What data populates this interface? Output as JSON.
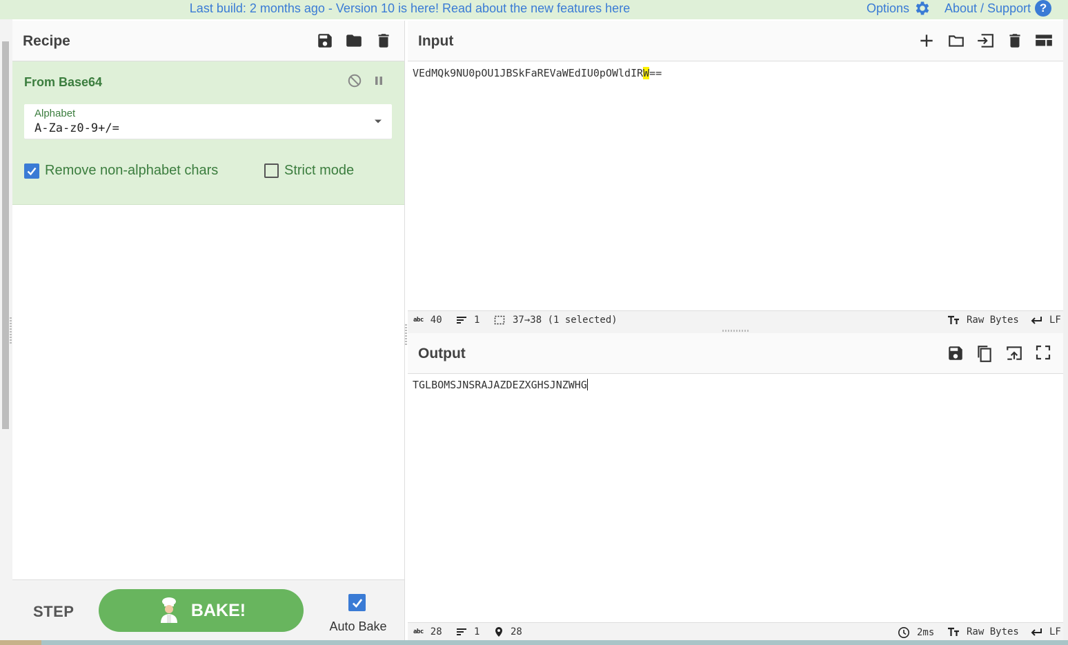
{
  "banner": {
    "message": "Last build: 2 months ago - Version 10 is here! Read about the new features here",
    "options_label": "Options",
    "about_label": "About / Support",
    "help_glyph": "?"
  },
  "recipe": {
    "title": "Recipe",
    "icons": [
      "save-icon",
      "folder-icon",
      "trash-icon"
    ],
    "operation": {
      "title": "From Base64",
      "alphabet_label": "Alphabet",
      "alphabet_value": "A-Za-z0-9+/=",
      "remove_non_alphabet_label": "Remove non-alphabet chars",
      "remove_non_alphabet_checked": true,
      "strict_mode_label": "Strict mode",
      "strict_mode_checked": false
    },
    "footer": {
      "step_label": "STEP",
      "bake_label": "BAKE!",
      "auto_bake_label": "Auto Bake",
      "auto_bake_checked": true
    }
  },
  "input": {
    "title": "Input",
    "text_before": "VEdMQk9NU0pOU1JBSkFaREVaWEdIU0pOWldIR",
    "text_selected": "W",
    "text_after": "==",
    "status": {
      "chars_label": "abc",
      "chars": "40",
      "lines": "1",
      "selection": "37→38 (1 selected)",
      "encoding": "Raw Bytes",
      "eol": "LF"
    }
  },
  "output": {
    "title": "Output",
    "text": "TGLBOMSJNSRAJAZDEZXGHSJNZWHG",
    "status": {
      "chars_label": "abc",
      "chars": "28",
      "lines": "1",
      "position": "28",
      "time": "2ms",
      "encoding": "Raw Bytes",
      "eol": "LF"
    }
  },
  "colors": {
    "banner_bg": "#dff0d8",
    "link": "#3a7bd5",
    "operation_bg": "#dff0d8",
    "operation_text": "#3b7d3e",
    "bake_button": "#68b55e",
    "selection_highlight": "#fff200"
  }
}
